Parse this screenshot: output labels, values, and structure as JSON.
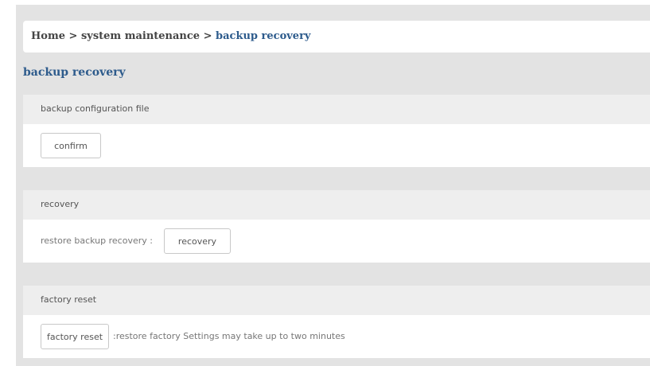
{
  "breadcrumb": {
    "home": "Home",
    "separator": ">",
    "system_maintenance": "system maintenance",
    "current": "backup recovery"
  },
  "page": {
    "title": "backup recovery"
  },
  "sections": {
    "backup": {
      "title": "backup configuration file",
      "confirm_button": "confirm"
    },
    "recovery": {
      "title": "recovery",
      "label": "restore backup recovery :",
      "recovery_button": "recovery"
    },
    "factory_reset": {
      "title": "factory reset",
      "factory_reset_button": "factory reset",
      "note": ":restore factory Settings may take up to two minutes"
    }
  },
  "colors": {
    "accent": "#2d5b8c",
    "panel_background": "#e3e3e3",
    "section_header_background": "#eeeeee"
  }
}
